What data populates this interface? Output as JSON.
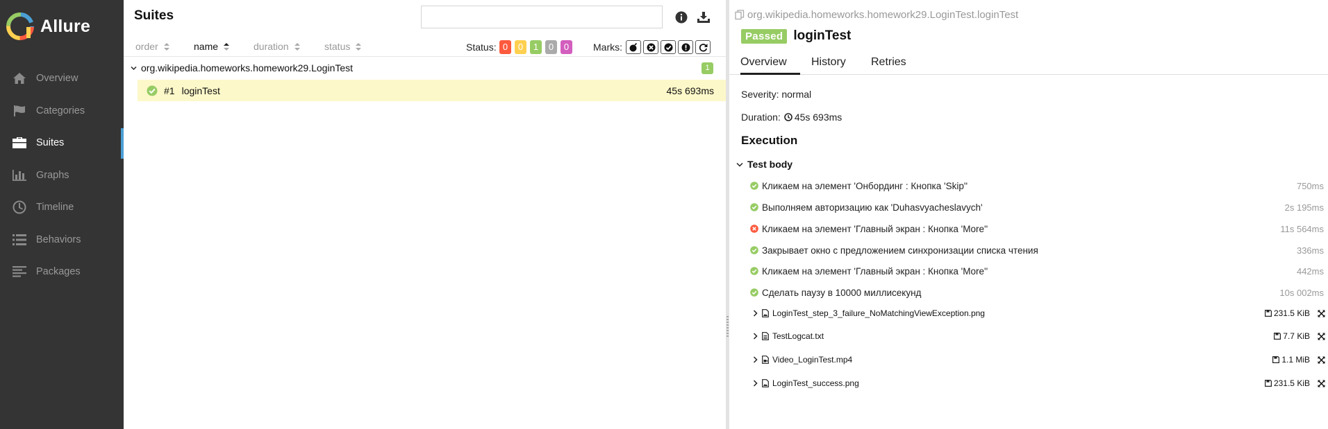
{
  "app": {
    "name": "Allure",
    "colors": {
      "sidebar": "#343434",
      "accent": "#4b9fd5",
      "passed": "#97cc64",
      "failed": "#fd5a3e",
      "broken": "#ffd050",
      "skipped": "#aaaaaa",
      "unknown": "#d35ebe",
      "selected_row": "#fcf8c9"
    }
  },
  "sidebar": {
    "items": [
      {
        "label": "Overview",
        "icon": "home-icon"
      },
      {
        "label": "Categories",
        "icon": "flag-icon"
      },
      {
        "label": "Suites",
        "icon": "briefcase-icon",
        "active": true
      },
      {
        "label": "Graphs",
        "icon": "bar-chart-icon"
      },
      {
        "label": "Timeline",
        "icon": "clock-icon"
      },
      {
        "label": "Behaviors",
        "icon": "list-icon"
      },
      {
        "label": "Packages",
        "icon": "align-left-icon"
      }
    ]
  },
  "suites": {
    "title": "Suites",
    "search": {
      "value": "",
      "placeholder": ""
    },
    "toolbar_icons": [
      "info-icon",
      "download-icon"
    ],
    "sort": {
      "order": "order",
      "name": "name",
      "duration": "duration",
      "status": "status"
    },
    "status_label": "Status:",
    "status_counts": [
      "0",
      "0",
      "1",
      "0",
      "0"
    ],
    "marks_label": "Marks:",
    "marks_icons": [
      "flaky-bomb-icon",
      "new-failed-icon",
      "new-passed-icon",
      "new-broken-icon",
      "retries-icon"
    ],
    "group": {
      "name": "org.wikipedia.homeworks.homework29.LoginTest",
      "count": "1"
    },
    "test": {
      "number": "#1",
      "name": "loginTest",
      "duration": "45s 693ms"
    }
  },
  "details": {
    "breadcrumb": "org.wikipedia.homeworks.homework29.LoginTest.loginTest",
    "status": "Passed",
    "title": "loginTest",
    "tabs": [
      "Overview",
      "History",
      "Retries"
    ],
    "severity": "Severity: normal",
    "duration_label": "Duration:",
    "duration_value": "45s 693ms",
    "execution_title": "Execution",
    "test_body": "Test body",
    "steps": [
      {
        "text": "Кликаем на элемент 'Онбординг : Кнопка 'Skip''",
        "duration": "750ms",
        "status": "passed"
      },
      {
        "text": "Выполняем авторизацию как 'Duhasvyacheslavych'",
        "duration": "2s 195ms",
        "status": "passed"
      },
      {
        "text": "Кликаем на элемент 'Главный экран : Кнопка 'More''",
        "duration": "11s 564ms",
        "status": "failed"
      },
      {
        "text": "Закрывает окно с предложением синхронизации списка чтения",
        "duration": "336ms",
        "status": "passed"
      },
      {
        "text": "Кликаем на элемент 'Главный экран : Кнопка 'More''",
        "duration": "442ms",
        "status": "passed"
      },
      {
        "text": "Сделать паузу в 10000 миллисекунд",
        "duration": "10s 002ms",
        "status": "passed"
      }
    ],
    "attachments": [
      {
        "name": "LoginTest_step_3_failure_NoMatchingViewException.png",
        "size": "231.5 KiB",
        "type": "image"
      },
      {
        "name": "TestLogcat.txt",
        "size": "7.7 KiB",
        "type": "text"
      },
      {
        "name": "Video_LoginTest.mp4",
        "size": "1.1 MiB",
        "type": "video"
      },
      {
        "name": "LoginTest_success.png",
        "size": "231.5 KiB",
        "type": "image"
      }
    ]
  }
}
